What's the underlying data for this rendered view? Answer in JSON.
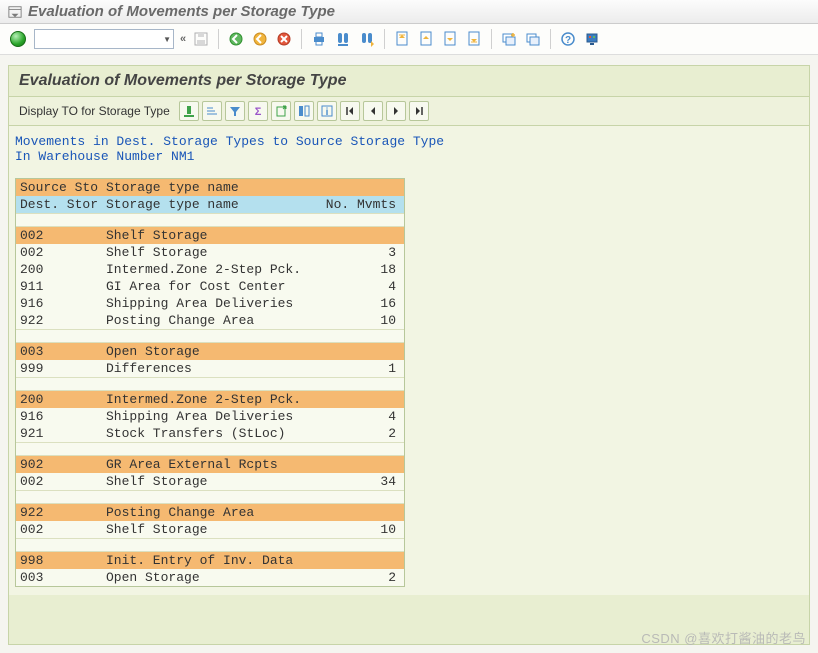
{
  "window": {
    "title": "Evaluation of Movements per Storage Type"
  },
  "content": {
    "title": "Evaluation of Movements per Storage Type",
    "sub_label": "Display TO for Storage Type",
    "info_line1": "Movements in Dest. Storage Types to Source Storage Type",
    "info_line2": "In Warehouse Number NM1"
  },
  "headers": {
    "src_code": "Source Sto",
    "src_name": "Storage type name",
    "dst_code": "Dest. Stor",
    "dst_name": "Storage type name",
    "mvmt": "No. Mvmts"
  },
  "groups": [
    {
      "src": {
        "code": "002",
        "name": "Shelf Storage"
      },
      "dests": [
        {
          "code": "002",
          "name": "Shelf Storage",
          "mvmt": "3"
        },
        {
          "code": "200",
          "name": "Intermed.Zone 2-Step Pck.",
          "mvmt": "18"
        },
        {
          "code": "911",
          "name": "GI Area for Cost Center",
          "mvmt": "4"
        },
        {
          "code": "916",
          "name": "Shipping Area Deliveries",
          "mvmt": "16"
        },
        {
          "code": "922",
          "name": "Posting Change Area",
          "mvmt": "10"
        }
      ]
    },
    {
      "src": {
        "code": "003",
        "name": "Open Storage"
      },
      "dests": [
        {
          "code": "999",
          "name": "Differences",
          "mvmt": "1"
        }
      ]
    },
    {
      "src": {
        "code": "200",
        "name": "Intermed.Zone 2-Step Pck."
      },
      "dests": [
        {
          "code": "916",
          "name": "Shipping Area Deliveries",
          "mvmt": "4"
        },
        {
          "code": "921",
          "name": "Stock Transfers (StLoc)",
          "mvmt": "2"
        }
      ]
    },
    {
      "src": {
        "code": "902",
        "name": "GR Area External Rcpts"
      },
      "dests": [
        {
          "code": "002",
          "name": "Shelf Storage",
          "mvmt": "34"
        }
      ]
    },
    {
      "src": {
        "code": "922",
        "name": "Posting Change Area"
      },
      "dests": [
        {
          "code": "002",
          "name": "Shelf Storage",
          "mvmt": "10"
        }
      ]
    },
    {
      "src": {
        "code": "998",
        "name": "Init. Entry of Inv. Data"
      },
      "dests": [
        {
          "code": "003",
          "name": "Open Storage",
          "mvmt": "2"
        }
      ]
    }
  ],
  "watermark": "CSDN @喜欢打酱油的老鸟"
}
